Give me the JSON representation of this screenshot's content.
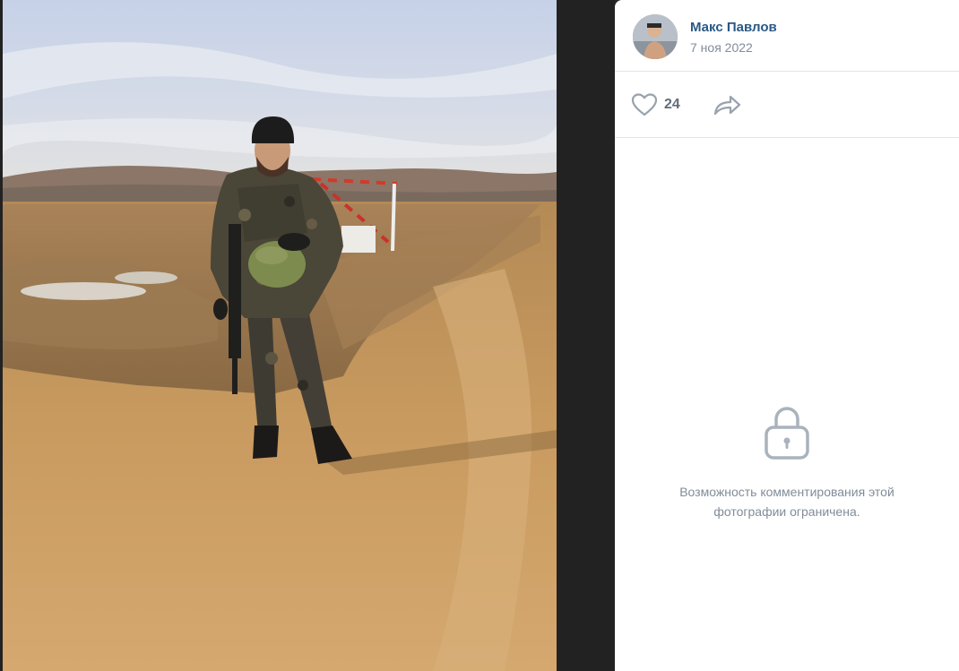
{
  "photo": {
    "description_icon": "photo-image"
  },
  "author": {
    "name": "Макс Павлов",
    "date": "7 ноя 2022",
    "avatar_icon": "avatar-image"
  },
  "actions": {
    "like_icon": "heart-icon",
    "like_count": "24",
    "share_icon": "share-icon"
  },
  "comments": {
    "lock_icon": "lock-icon",
    "restricted_message": "Возможность комментирования этой фотографии ограничена."
  },
  "colors": {
    "author_link": "#2a5885",
    "muted_text": "#818c99",
    "icon": "#99a2ad",
    "panel_bg": "#ffffff",
    "viewer_bg": "#2a2a2a"
  }
}
